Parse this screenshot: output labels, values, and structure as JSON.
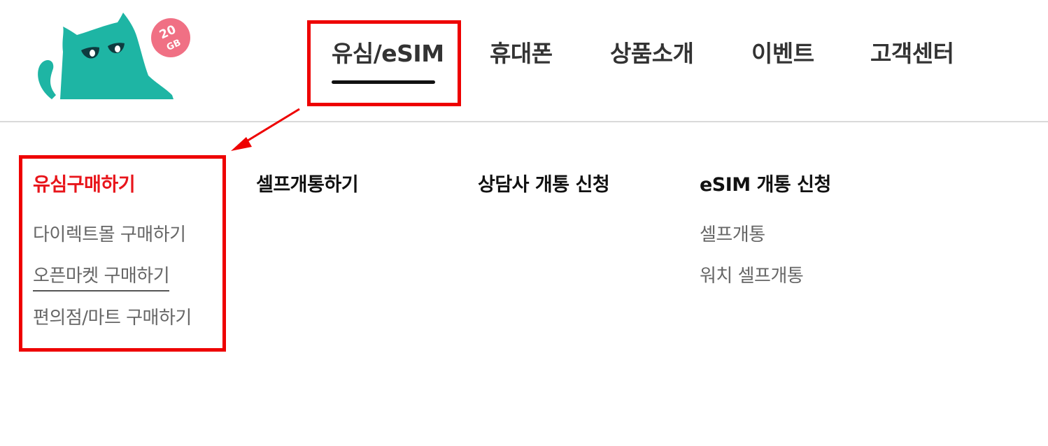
{
  "logo": {
    "badge_text": "20\nGB"
  },
  "nav": {
    "items": [
      {
        "label": "유심/eSIM"
      },
      {
        "label": "휴대폰"
      },
      {
        "label": "상품소개"
      },
      {
        "label": "이벤트"
      },
      {
        "label": "고객센터"
      }
    ],
    "active_index": 0
  },
  "megamenu": {
    "columns": [
      {
        "title": "유심구매하기",
        "items": [
          "다이렉트몰 구매하기",
          "오픈마켓 구매하기",
          "편의점/마트 구매하기"
        ]
      },
      {
        "title": "셀프개통하기",
        "items": []
      },
      {
        "title": "상담사 개통 신청",
        "items": []
      },
      {
        "title": "eSIM 개통 신청",
        "items": [
          "셀프개통",
          "워치 셀프개통"
        ]
      }
    ]
  },
  "colors": {
    "highlight": "#ee0000",
    "active_title": "#e8151b",
    "cat": "#1eb5a4",
    "badge": "#f07084"
  }
}
